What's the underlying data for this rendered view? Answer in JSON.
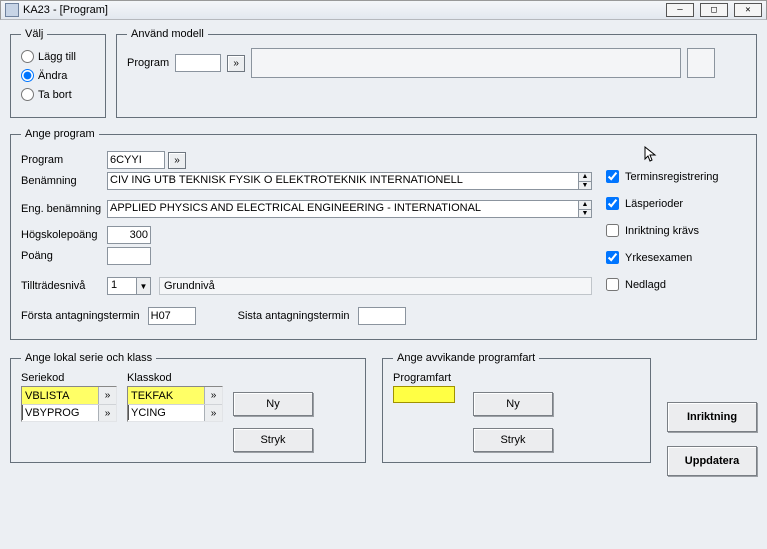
{
  "title": "KA23 - [Program]",
  "valj": {
    "legend": "Välj",
    "add": "Lägg till",
    "edit": "Ändra",
    "del": "Ta bort"
  },
  "modell": {
    "legend": "Använd modell",
    "program_label": "Program"
  },
  "ange": {
    "legend": "Ange program",
    "program_label": "Program",
    "program_value": "6CYYI",
    "benamning_label": "Benämning",
    "benamning_value": "CIV ING UTB TEKNISK FYSIK O ELEKTROTEKNIK INTERNATIONELL",
    "engbenamning_label": "Eng. benämning",
    "engbenamning_value": "APPLIED PHYSICS AND ELECTRICAL ENGINEERING - INTERNATIONAL",
    "hpoang_label": "Högskolepoäng",
    "hpoang_value": "300",
    "poang_label": "Poäng",
    "tilltrades_label": "Tillträdesnivå",
    "tilltrades_value": "1",
    "tilltrades_text": "Grundnivå",
    "forsta_label": "Första antagningstermin",
    "forsta_value": "H07",
    "sista_label": "Sista antagningstermin",
    "sista_value": "",
    "chk_terminsreg": "Terminsregistrering",
    "chk_lasperioder": "Läsperioder",
    "chk_inriktning": "Inriktning krävs",
    "chk_yrkes": "Yrkesexamen",
    "chk_nedlagd": "Nedlagd"
  },
  "serie": {
    "legend": "Ange lokal serie och klass",
    "seriekod_label": "Seriekod",
    "klasskod_label": "Klasskod",
    "series": [
      {
        "code": "VBLISTA",
        "sel": true
      },
      {
        "code": "VBYPROG",
        "sel": false
      }
    ],
    "klass": [
      {
        "code": "TEKFAK",
        "sel": true
      },
      {
        "code": "YCING",
        "sel": false
      }
    ],
    "ny": "Ny",
    "stryk": "Stryk"
  },
  "fart": {
    "legend": "Ange avvikande programfart",
    "label": "Programfart",
    "ny": "Ny",
    "stryk": "Stryk"
  },
  "btns": {
    "inriktning": "Inriktning",
    "uppdatera": "Uppdatera"
  }
}
